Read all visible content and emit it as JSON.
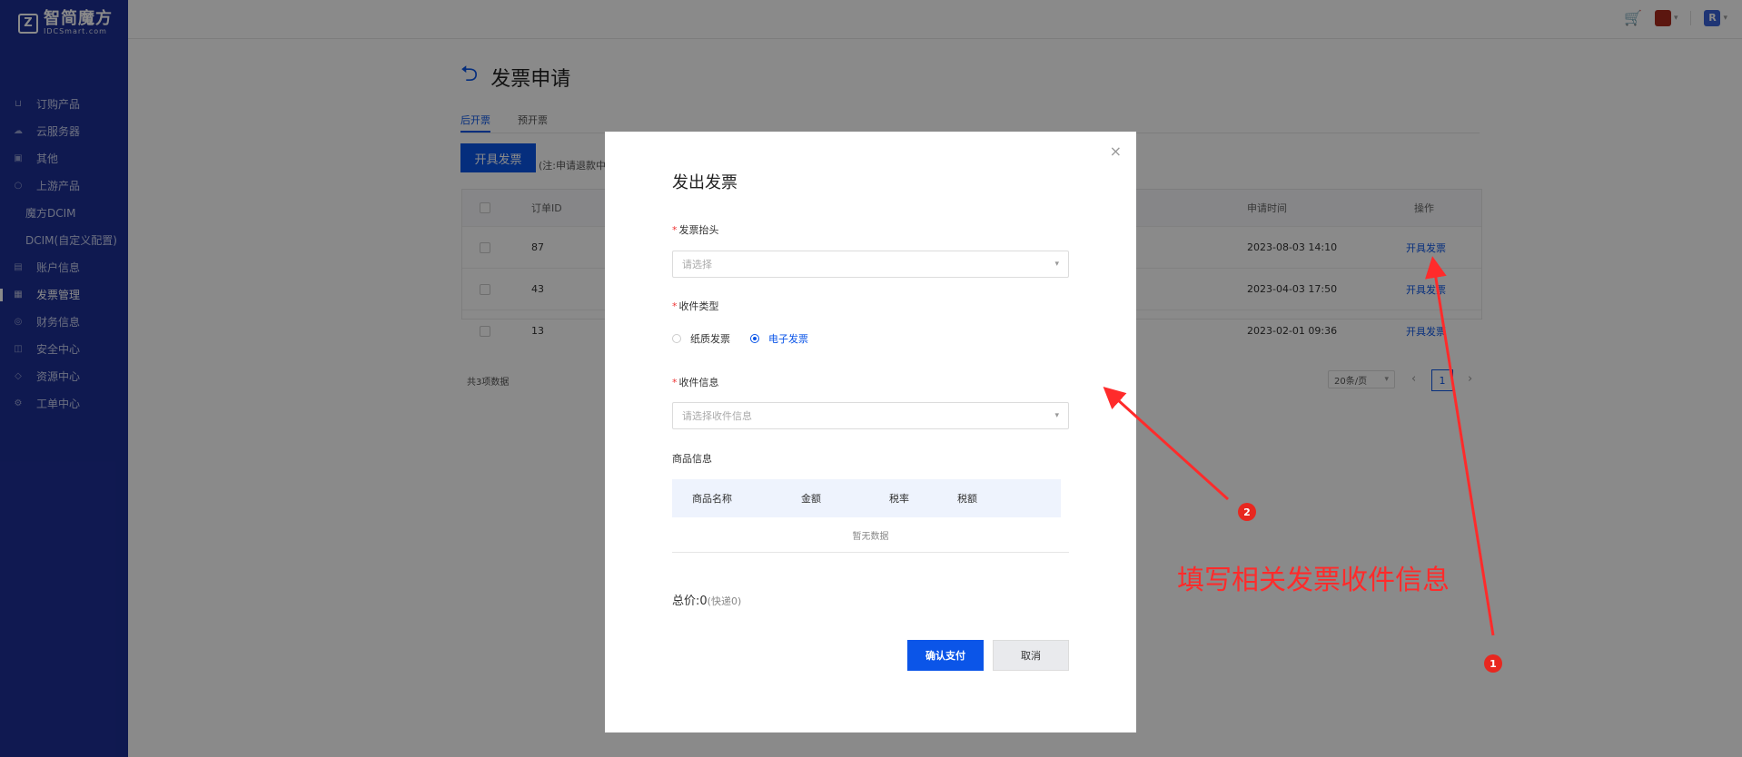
{
  "brand": {
    "name": "智简魔方",
    "sub": "IDCSmart.com",
    "mark": "Z"
  },
  "sidebar": {
    "items": [
      {
        "label": "订购产品",
        "icon": "cart-icon"
      },
      {
        "label": "云服务器",
        "icon": "cloud-icon"
      },
      {
        "label": "其他",
        "icon": "box-icon"
      },
      {
        "label": "上游产品",
        "icon": "upstream-icon"
      },
      {
        "label": "魔方DCIM",
        "icon": ""
      },
      {
        "label": "DCIM(自定义配置)",
        "icon": ""
      },
      {
        "label": "账户信息",
        "icon": "account-icon"
      },
      {
        "label": "发票管理",
        "icon": "invoice-icon"
      },
      {
        "label": "财务信息",
        "icon": "finance-icon"
      },
      {
        "label": "安全中心",
        "icon": "lock-icon"
      },
      {
        "label": "资源中心",
        "icon": "resource-icon"
      },
      {
        "label": "工单中心",
        "icon": "ticket-icon"
      }
    ]
  },
  "topbar": {
    "avatar_color": "#a8291c",
    "user_initial": "R"
  },
  "page": {
    "title": "发票申请",
    "tabs": [
      "后开票",
      "预开票"
    ],
    "issue_button": "开具发票",
    "note": "(注:申请退款中",
    "table": {
      "headers": {
        "order_id": "订单ID",
        "time": "申请时间",
        "action": "操作"
      },
      "rows": [
        {
          "order_id": "87",
          "time": "2023-08-03 14:10",
          "action": "开具发票"
        },
        {
          "order_id": "43",
          "time": "2023-04-03 17:50",
          "action": "开具发票"
        },
        {
          "order_id": "13",
          "time": "2023-02-01 09:36",
          "action": "开具发票"
        }
      ]
    },
    "total_count": "共3项数据",
    "page_size": "20条/页",
    "current_page": "1"
  },
  "modal": {
    "title": "发出发票",
    "invoice_header": {
      "label": "发票抬头",
      "placeholder": "请选择"
    },
    "receive_type": {
      "label": "收件类型",
      "options": [
        "纸质发票",
        "电子发票"
      ],
      "selected": "电子发票"
    },
    "receive_info": {
      "label": "收件信息",
      "placeholder": "请选择收件信息"
    },
    "goods": {
      "label": "商品信息",
      "headers": [
        "商品名称",
        "金额",
        "税率",
        "税额"
      ],
      "empty": "暂无数据"
    },
    "total_label": "总价:0",
    "total_sub": "(快递0)",
    "confirm_button": "确认支付",
    "cancel_button": "取消"
  },
  "annotation": {
    "text": "填写相关发票收件信息",
    "badge1": "1",
    "badge2": "2",
    "color": "#ff2b2b"
  }
}
